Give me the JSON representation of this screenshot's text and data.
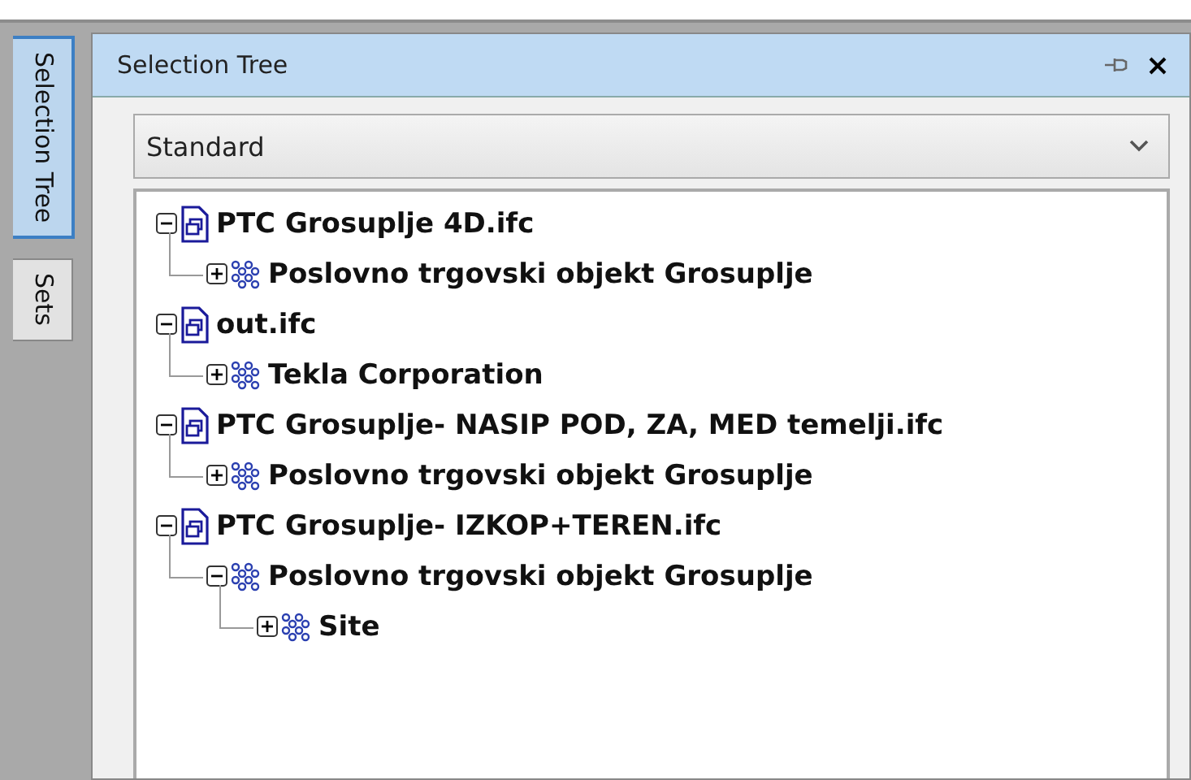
{
  "side_tabs": [
    {
      "label": "Selection Tree",
      "selected": true
    },
    {
      "label": "Sets",
      "selected": false
    }
  ],
  "panel": {
    "title": "Selection Tree",
    "dropdown": {
      "value": "Standard"
    }
  },
  "tree": [
    {
      "kind": "file",
      "label": "PTC Grosuplje 4D.ifc",
      "expanded": true,
      "children": [
        {
          "kind": "group",
          "label": "Poslovno trgovski objekt Grosuplje",
          "expanded": false
        }
      ]
    },
    {
      "kind": "file",
      "label": "out.ifc",
      "expanded": true,
      "children": [
        {
          "kind": "group",
          "label": "Tekla Corporation",
          "expanded": false
        }
      ]
    },
    {
      "kind": "file",
      "label": "PTC Grosuplje- NASIP POD, ZA, MED temelji.ifc",
      "expanded": true,
      "children": [
        {
          "kind": "group",
          "label": "Poslovno trgovski objekt Grosuplje",
          "expanded": false
        }
      ]
    },
    {
      "kind": "file",
      "label": "PTC Grosuplje- IZKOP+TEREN.ifc",
      "expanded": true,
      "children": [
        {
          "kind": "group",
          "label": "Poslovno trgovski objekt Grosuplje",
          "expanded": true,
          "children": [
            {
              "kind": "group",
              "label": "Site",
              "expanded": false
            }
          ]
        }
      ]
    }
  ]
}
